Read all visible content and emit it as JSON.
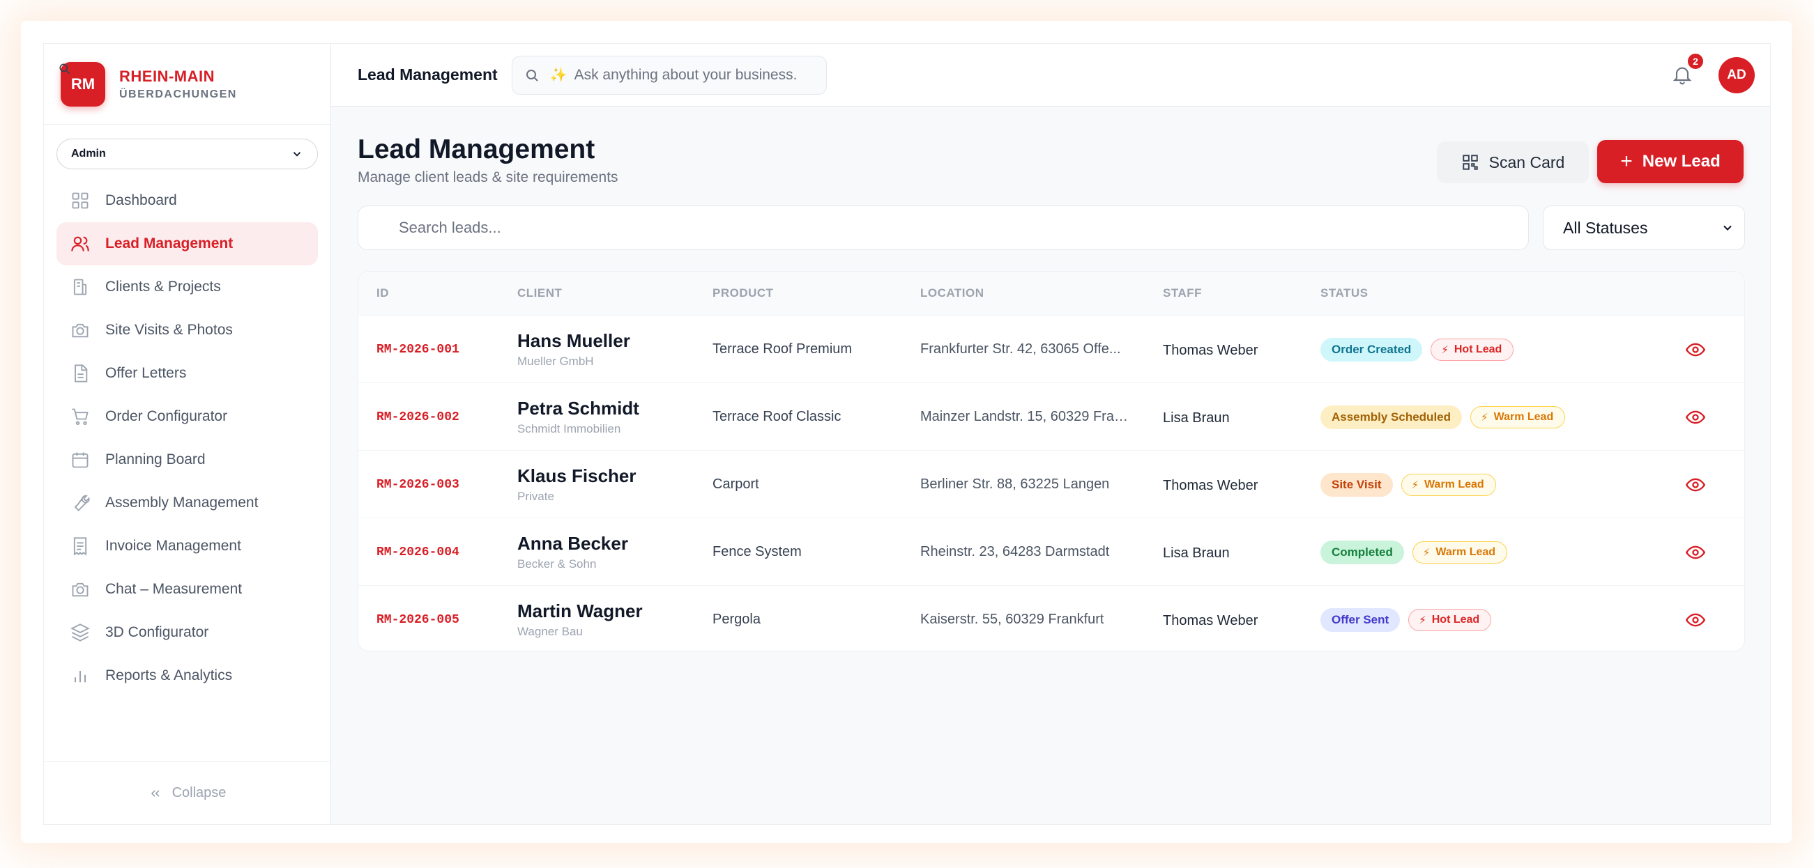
{
  "brand": {
    "logo": "RM",
    "name": "RHEIN-MAIN",
    "sub": "ÜBERDACHUNGEN"
  },
  "role_select": {
    "value": "Admin"
  },
  "sidebar": {
    "items": [
      {
        "label": "Dashboard",
        "icon": "grid-icon",
        "active": false
      },
      {
        "label": "Lead Management",
        "icon": "users-icon",
        "active": true
      },
      {
        "label": "Clients & Projects",
        "icon": "building-icon",
        "active": false
      },
      {
        "label": "Site Visits & Photos",
        "icon": "camera-icon",
        "active": false
      },
      {
        "label": "Offer Letters",
        "icon": "document-icon",
        "active": false
      },
      {
        "label": "Order Configurator",
        "icon": "cart-icon",
        "active": false
      },
      {
        "label": "Planning Board",
        "icon": "calendar-icon",
        "active": false
      },
      {
        "label": "Assembly Management",
        "icon": "wrench-icon",
        "active": false
      },
      {
        "label": "Invoice Management",
        "icon": "receipt-icon",
        "active": false
      },
      {
        "label": "Chat – Measurement",
        "icon": "camera-icon",
        "active": false
      },
      {
        "label": "3D Configurator",
        "icon": "layers-icon",
        "active": false
      },
      {
        "label": "Reports & Analytics",
        "icon": "bar-chart-icon",
        "active": false
      }
    ],
    "collapse_label": "Collapse"
  },
  "topbar": {
    "title": "Lead Management",
    "ask_placeholder": "Ask anything about your business.",
    "notifications_count": "2",
    "avatar_initials": "AD"
  },
  "page": {
    "title": "Lead Management",
    "subtitle": "Manage client leads & site requirements",
    "scan_label": "Scan Card",
    "new_label": "New Lead",
    "search_placeholder": "Search leads...",
    "status_filter": "All Statuses"
  },
  "table": {
    "headers": [
      "ID",
      "CLIENT",
      "PRODUCT",
      "LOCATION",
      "STAFF",
      "STATUS"
    ],
    "rows": [
      {
        "id": "RM-2026-001",
        "client": "Hans Mueller",
        "company": "Mueller GmbH",
        "product": "Terrace Roof Premium",
        "location": "Frankfurter Str. 42, 63065 Offe...",
        "staff": "Thomas Weber",
        "status": "Order Created",
        "lead": "Hot Lead"
      },
      {
        "id": "RM-2026-002",
        "client": "Petra Schmidt",
        "company": "Schmidt Immobilien",
        "product": "Terrace Roof Classic",
        "location": "Mainzer Landstr. 15, 60329 Fran...",
        "staff": "Lisa Braun",
        "status": "Assembly Scheduled",
        "lead": "Warm Lead"
      },
      {
        "id": "RM-2026-003",
        "client": "Klaus Fischer",
        "company": "Private",
        "product": "Carport",
        "location": "Berliner Str. 88, 63225 Langen",
        "staff": "Thomas Weber",
        "status": "Site Visit",
        "lead": "Warm Lead"
      },
      {
        "id": "RM-2026-004",
        "client": "Anna Becker",
        "company": "Becker & Sohn",
        "product": "Fence System",
        "location": "Rheinstr. 23, 64283 Darmstadt",
        "staff": "Lisa Braun",
        "status": "Completed",
        "lead": "Warm Lead"
      },
      {
        "id": "RM-2026-005",
        "client": "Martin Wagner",
        "company": "Wagner Bau",
        "product": "Pergola",
        "location": "Kaiserstr. 55, 60329 Frankfurt",
        "staff": "Thomas Weber",
        "status": "Offer Sent",
        "lead": "Hot Lead"
      }
    ]
  },
  "colors": {
    "accent": "#d81f26",
    "status_order_created": "#cff7fb",
    "status_assembly": "#fdefc3",
    "status_site_visit": "#fde6cc",
    "status_completed": "#c9f3da",
    "status_offer_sent": "#e0e7ff"
  }
}
